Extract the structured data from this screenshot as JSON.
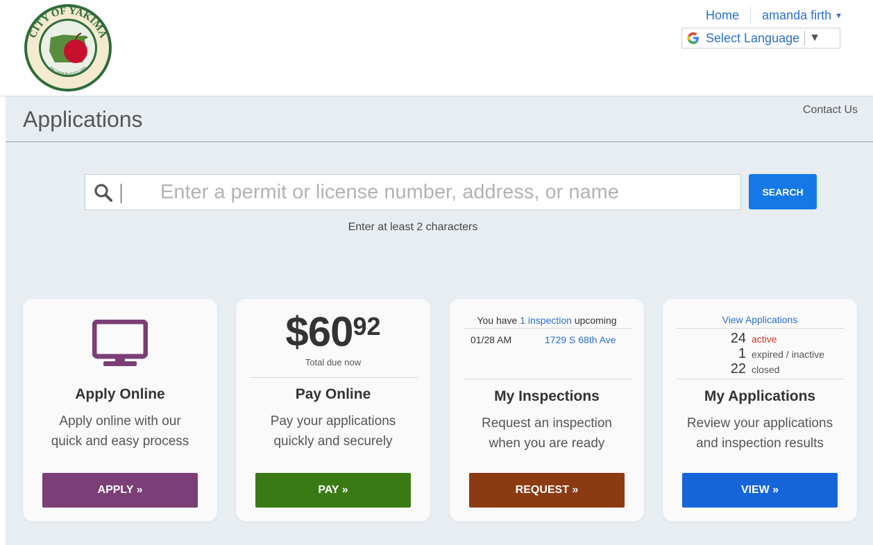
{
  "header": {
    "logo_alt": "City of Yakima seal",
    "logo_text": "CITY OF YAKIMA",
    "logo_sub": "INCORPORATED 1886",
    "home": "Home",
    "user": "amanda firth",
    "language": "Select Language"
  },
  "page": {
    "title": "Applications",
    "contact": "Contact Us"
  },
  "search": {
    "placeholder": "Enter a permit or license number, address, or name",
    "button": "SEARCH",
    "hint": "Enter at least 2 characters"
  },
  "cards": {
    "apply": {
      "title": "Apply Online",
      "desc1": "Apply online with our",
      "desc2": "quick and easy process",
      "button": "APPLY »",
      "color": "#7b3e76"
    },
    "pay": {
      "amount_dollars": "$60",
      "amount_cents": "92",
      "due_label": "Total due now",
      "title": "Pay Online",
      "desc1": "Pay your applications",
      "desc2": "quickly and securely",
      "button": "PAY »",
      "color": "#3a7a15"
    },
    "inspections": {
      "pre": "You have",
      "count_link": "1 inspection",
      "post": "upcoming",
      "date": "01/28 AM",
      "address": "1729 S 68th Ave",
      "title": "My Inspections",
      "desc1": "Request an inspection",
      "desc2": "when you are ready",
      "button": "REQUEST »",
      "color": "#8c3a12"
    },
    "applications": {
      "link": "View Applications",
      "stats": [
        {
          "num": "24",
          "label": "active"
        },
        {
          "num": "1",
          "label": "expired / inactive"
        },
        {
          "num": "22",
          "label": "closed"
        }
      ],
      "title": "My Applications",
      "desc1": "Review your applications",
      "desc2": "and inspection results",
      "button": "VIEW »",
      "color": "#1565d8"
    }
  },
  "colors": {
    "active_red": "#c0392b",
    "link_blue": "#2a6fc9",
    "search_blue": "#1479e6",
    "bg": "#e8edf2",
    "monitor_purple": "#7b3e76"
  }
}
